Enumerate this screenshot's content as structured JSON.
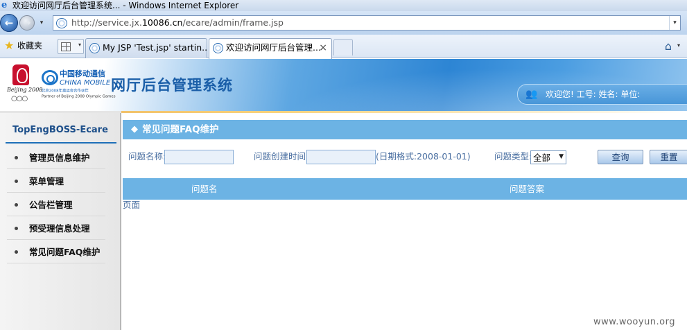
{
  "window": {
    "title": "欢迎访问网厅后台管理系统... - Windows Internet Explorer"
  },
  "address_bar": {
    "url_prefix": "http://service.jx.",
    "url_domain": "10086.cn",
    "url_suffix": "/ecare/admin/frame.jsp"
  },
  "favorites": {
    "label": "收藏夹"
  },
  "tabs": [
    {
      "label": "My JSP 'Test.jsp' startin..."
    },
    {
      "label": "欢迎访问网厅后台管理...",
      "close": "×"
    }
  ],
  "header": {
    "olympic_text": "Beijing 2008",
    "brand_cn": "中国移动通信",
    "brand_en": "CHINA MOBILE",
    "partner_cn": "北京2008年奥运会合作伙伴",
    "partner_en": "Partner of Beijing 2008 Olympic Games",
    "system_title": "网厅后台管理系统",
    "welcome": "欢迎您! 工号:  姓名:  单位:"
  },
  "sidebar": {
    "brand": "TopEngBOSS-Ecare",
    "items": [
      {
        "label": "管理员信息维护"
      },
      {
        "label": "菜单管理"
      },
      {
        "label": "公告栏管理"
      },
      {
        "label": "预受理信息处理"
      },
      {
        "label": "常见问题FAQ维护"
      }
    ]
  },
  "main": {
    "section_title": "常见问题FAQ维护",
    "form": {
      "name_label": "问题名称:",
      "name_value": "",
      "created_label": "问题创建时间:",
      "created_value": "",
      "date_hint": "(日期格式:2008-01-01)",
      "type_label": "问题类型:",
      "type_value": "全部",
      "query_button": "查询",
      "reset_button": "重置"
    },
    "table": {
      "columns": [
        "问题名",
        "问题答案"
      ],
      "pager": "页面"
    }
  },
  "watermark": "www.wooyun.org",
  "colors": {
    "section_bar": "#6cb3e4",
    "sidebar_brand": "#1d4f8a",
    "title_blue": "#1a5ea8"
  }
}
